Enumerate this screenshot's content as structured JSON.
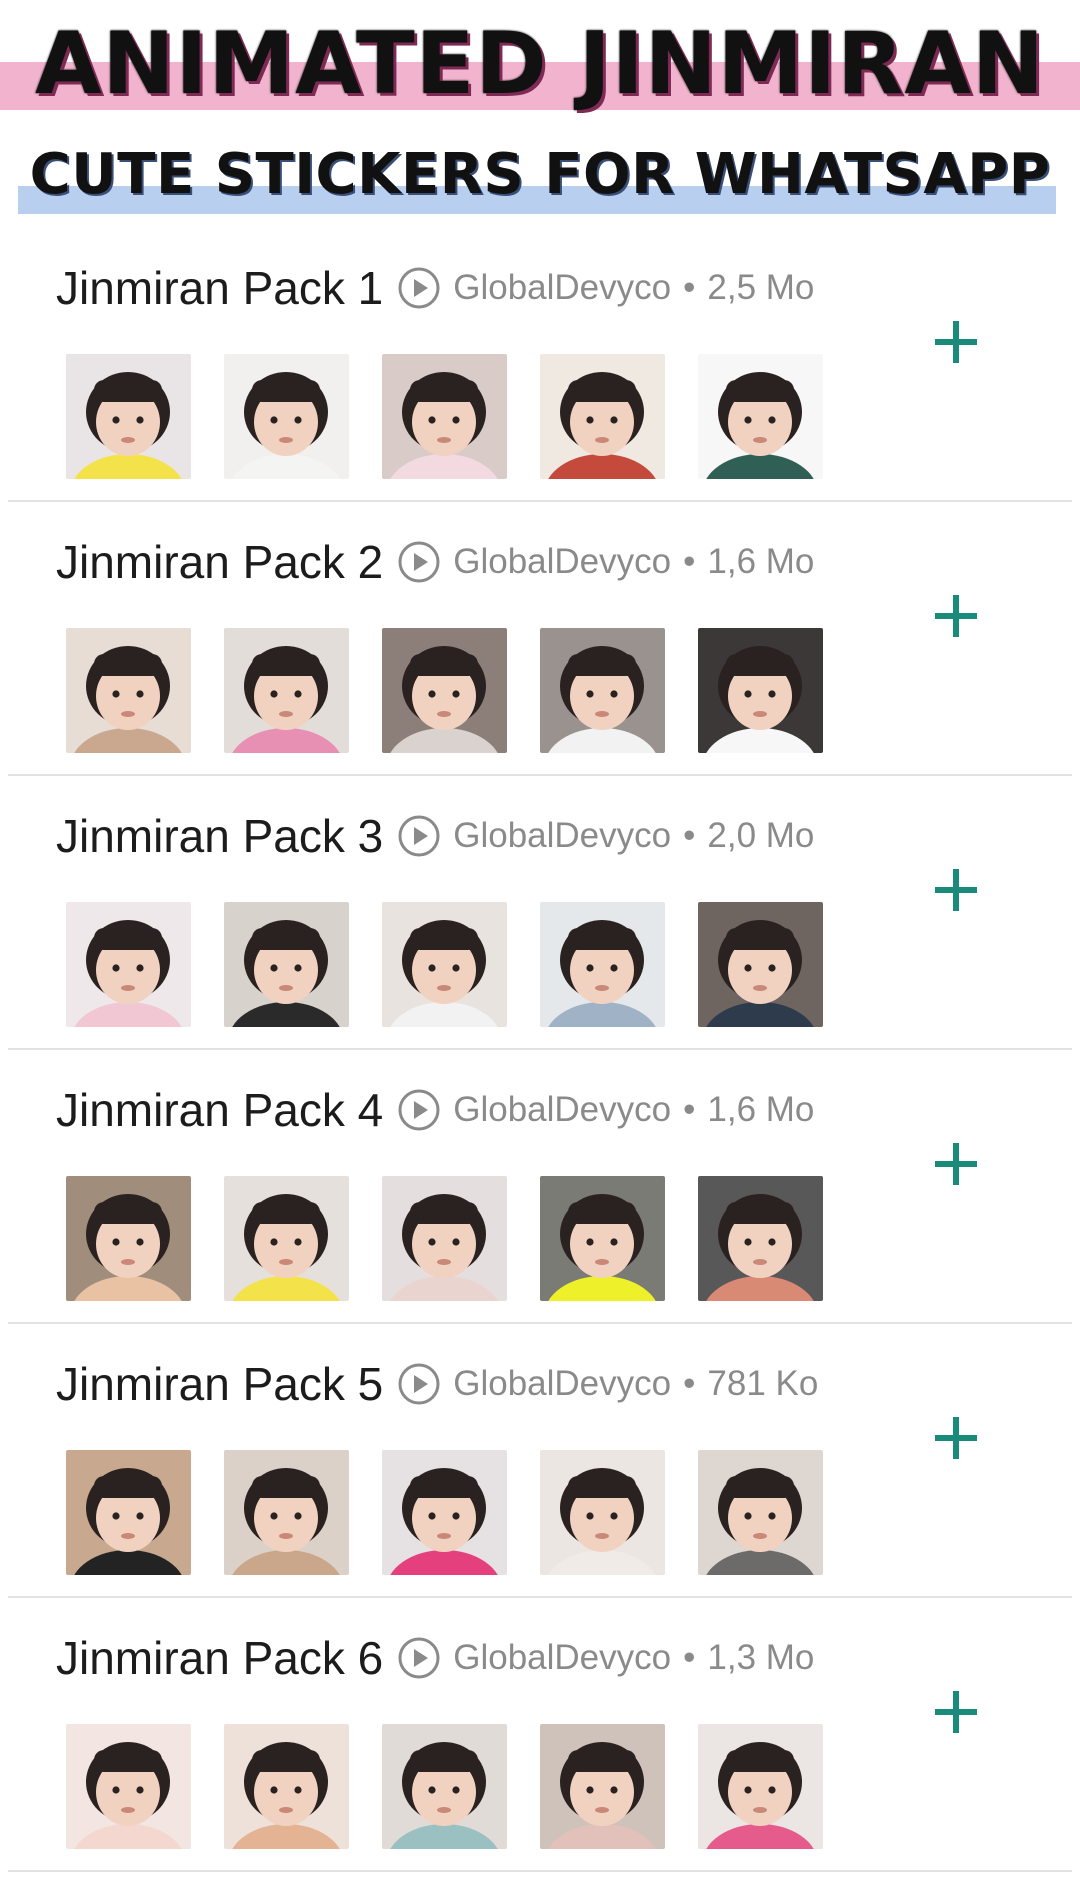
{
  "banner": {
    "title": "ANIMATED JINMIRAN",
    "subtitle": "CUTE STICKERS FOR WHATSAPP"
  },
  "colors": {
    "accent": "#1a8a7a",
    "pink_band": "#f1b3cd",
    "blue_band": "#b9cff0",
    "meta_text": "#8a8a8a"
  },
  "packs": [
    {
      "name": "Jinmiran Pack 1",
      "publisher": "GlobalDevyco",
      "size": "2,5 Mo",
      "stickers": [
        {
          "bg": "#e9e4e6",
          "shirt": "#f3e24a"
        },
        {
          "bg": "#f2f0ee",
          "shirt": "#f4f4f2"
        },
        {
          "bg": "#d9cbc7",
          "shirt": "#f3d9e0"
        },
        {
          "bg": "#efe9e2",
          "shirt": "#c44a3c"
        },
        {
          "bg": "#f7f7f7",
          "shirt": "#2f5f55"
        }
      ]
    },
    {
      "name": "Jinmiran Pack 2",
      "publisher": "GlobalDevyco",
      "size": "1,6 Mo",
      "stickers": [
        {
          "bg": "#e7ddd5",
          "shirt": "#caa88f"
        },
        {
          "bg": "#e3ddd9",
          "shirt": "#e88fb4"
        },
        {
          "bg": "#8c7f7a",
          "shirt": "#d9d2cf"
        },
        {
          "bg": "#9a928f",
          "shirt": "#f2f2f2"
        },
        {
          "bg": "#3c3838",
          "shirt": "#f7f7f7"
        }
      ]
    },
    {
      "name": "Jinmiran Pack 3",
      "publisher": "GlobalDevyco",
      "size": "2,0 Mo",
      "stickers": [
        {
          "bg": "#efe8ea",
          "shirt": "#f0c7d3"
        },
        {
          "bg": "#d8d2cd",
          "shirt": "#2a2a2a"
        },
        {
          "bg": "#e8e3df",
          "shirt": "#f2f2f2"
        },
        {
          "bg": "#e5e8ea",
          "shirt": "#9fb2c6"
        },
        {
          "bg": "#6e6460",
          "shirt": "#2d3b4d"
        }
      ]
    },
    {
      "name": "Jinmiran Pack 4",
      "publisher": "GlobalDevyco",
      "size": "1,6 Mo",
      "stickers": [
        {
          "bg": "#a18d7c",
          "shirt": "#e8c2a3"
        },
        {
          "bg": "#e6e0dd",
          "shirt": "#f3e24a"
        },
        {
          "bg": "#e4dedf",
          "shirt": "#e9d4d0"
        },
        {
          "bg": "#7a7b74",
          "shirt": "#eef02a"
        },
        {
          "bg": "#595859",
          "shirt": "#d98a74"
        }
      ]
    },
    {
      "name": "Jinmiran Pack 5",
      "publisher": "GlobalDevyco",
      "size": "781 Ko",
      "stickers": [
        {
          "bg": "#c8a98f",
          "shirt": "#232323"
        },
        {
          "bg": "#dcd1c9",
          "shirt": "#caa68a"
        },
        {
          "bg": "#e6e2e4",
          "shirt": "#e4407e"
        },
        {
          "bg": "#ece6e2",
          "shirt": "#f1ebe7"
        },
        {
          "bg": "#ddd6d1",
          "shirt": "#6d6b69"
        }
      ]
    },
    {
      "name": "Jinmiran Pack 6",
      "publisher": "GlobalDevyco",
      "size": "1,3 Mo",
      "stickers": [
        {
          "bg": "#f2e5e2",
          "shirt": "#f4d8cf"
        },
        {
          "bg": "#eee1da",
          "shirt": "#e3b394"
        },
        {
          "bg": "#e1dbd7",
          "shirt": "#9ac0c2"
        },
        {
          "bg": "#cfc2ba",
          "shirt": "#e3c1bb"
        },
        {
          "bg": "#ebe5e4",
          "shirt": "#e55b8c"
        }
      ]
    }
  ],
  "icons": {
    "play": "play-circle-icon",
    "add": "plus-icon",
    "sticker": "sticker-thumbnail"
  }
}
